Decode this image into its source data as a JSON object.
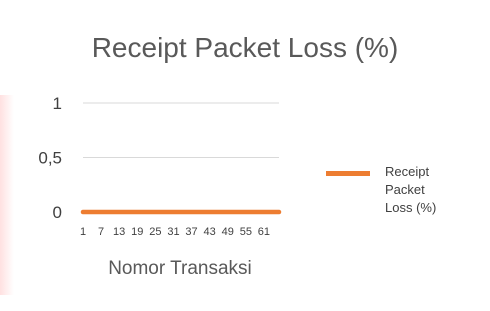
{
  "chart_data": {
    "type": "line",
    "title": "Receipt Packet Loss (%)",
    "xlabel": "Nomor Transaksi",
    "ylabel": "",
    "ylim": [
      0,
      1
    ],
    "y_ticks": [
      "0",
      "0,5",
      "1"
    ],
    "y_tick_values": [
      0,
      0.5,
      1
    ],
    "x_ticks": [
      "1",
      "7",
      "13",
      "19",
      "25",
      "31",
      "37",
      "43",
      "49",
      "55",
      "61"
    ],
    "x_range": [
      1,
      66
    ],
    "grid": true,
    "legend_position": "right",
    "series": [
      {
        "name": "Receipt Packet Loss (%)",
        "color": "#ED7D31",
        "x_start": 1,
        "x_end": 66,
        "values": [
          0
        ]
      }
    ]
  }
}
